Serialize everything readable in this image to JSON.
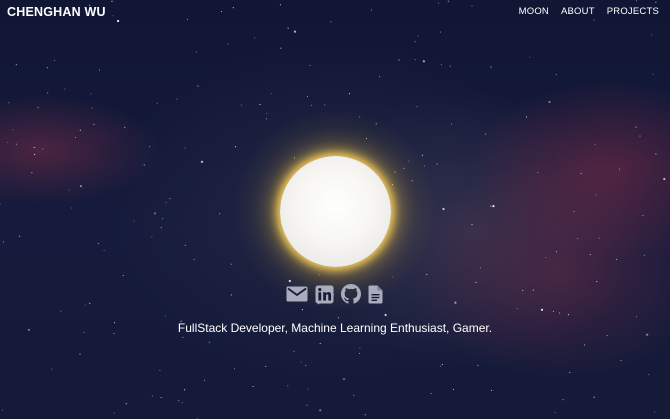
{
  "header": {
    "brand": "CHENGHAN WU",
    "nav": [
      {
        "label": "MOON"
      },
      {
        "label": "ABOUT"
      },
      {
        "label": "PROJECTS"
      }
    ]
  },
  "hero": {
    "tagline": "FullStack Developer, Machine Learning Enthusiast, Gamer.",
    "social_icons": [
      "mail-icon",
      "linkedin-icon",
      "github-icon",
      "resume-document-icon"
    ]
  },
  "colors": {
    "background": "#151a3a",
    "moon": "#f5f4f0",
    "moon_glow": "#e6c04a",
    "nebula": "#7a2d46",
    "icon": "#a9adbb",
    "text": "#ffffff"
  }
}
